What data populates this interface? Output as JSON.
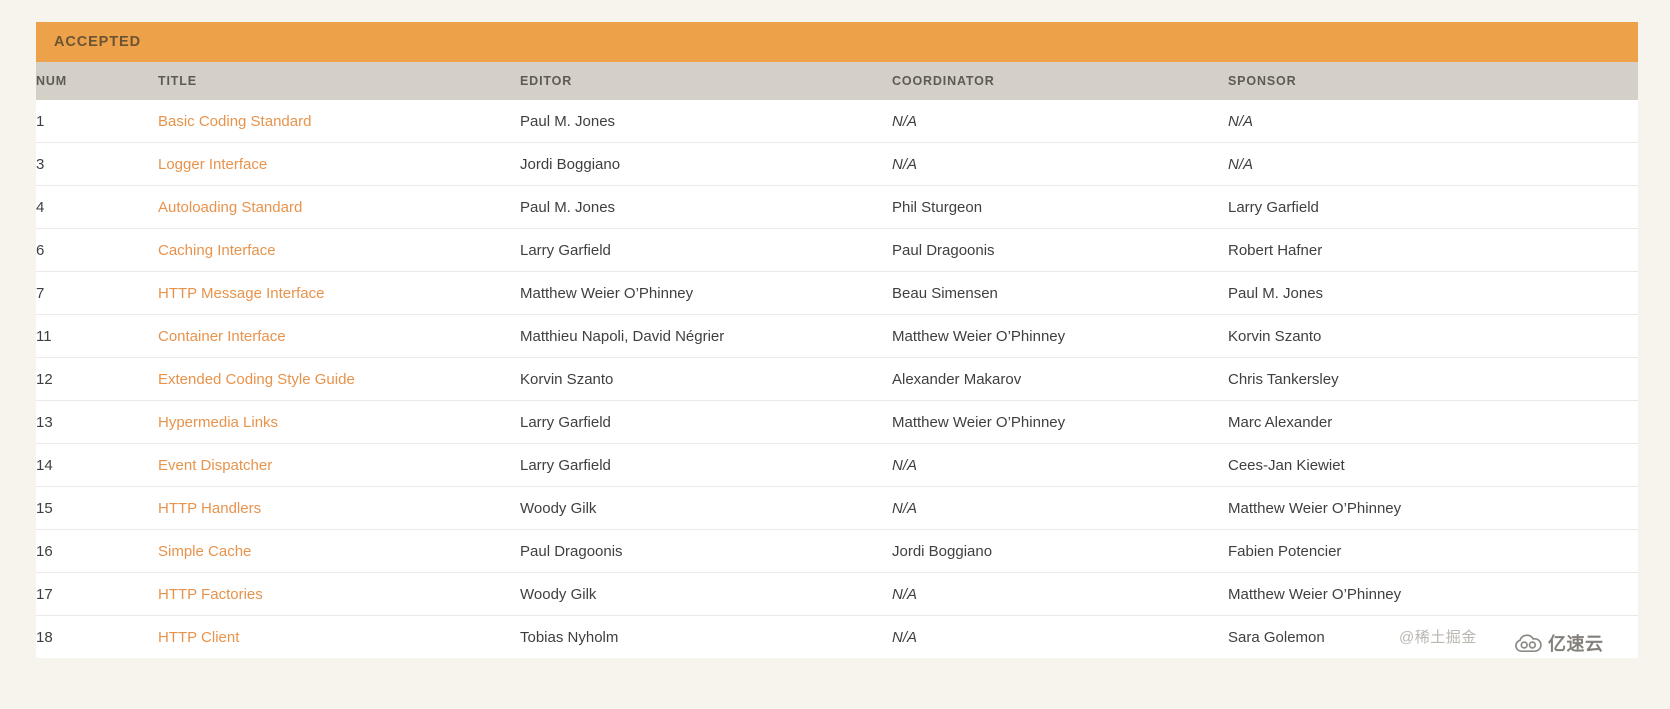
{
  "section": {
    "title": "ACCEPTED",
    "header_bg": "#eda149",
    "header_text_color": "#6b5433"
  },
  "table": {
    "columns": [
      {
        "key": "num",
        "label": "NUM"
      },
      {
        "key": "title",
        "label": "TITLE"
      },
      {
        "key": "editor",
        "label": "EDITOR"
      },
      {
        "key": "coordinator",
        "label": "COORDINATOR"
      },
      {
        "key": "sponsor",
        "label": "SPONSOR"
      }
    ],
    "link_color": "#e8934c",
    "header_row_bg": "#d4d0c8",
    "rows": [
      {
        "num": "1",
        "title": "Basic Coding Standard",
        "editor": "Paul M. Jones",
        "coordinator": "N/A",
        "sponsor": "N/A",
        "coordinator_na": true,
        "sponsor_na": true
      },
      {
        "num": "3",
        "title": "Logger Interface",
        "editor": "Jordi Boggiano",
        "coordinator": "N/A",
        "sponsor": "N/A",
        "coordinator_na": true,
        "sponsor_na": true
      },
      {
        "num": "4",
        "title": "Autoloading Standard",
        "editor": "Paul M. Jones",
        "coordinator": "Phil Sturgeon",
        "sponsor": "Larry Garfield",
        "coordinator_na": false,
        "sponsor_na": false
      },
      {
        "num": "6",
        "title": "Caching Interface",
        "editor": "Larry Garfield",
        "coordinator": "Paul Dragoonis",
        "sponsor": "Robert Hafner",
        "coordinator_na": false,
        "sponsor_na": false
      },
      {
        "num": "7",
        "title": "HTTP Message Interface",
        "editor": "Matthew Weier O’Phinney",
        "coordinator": "Beau Simensen",
        "sponsor": "Paul M. Jones",
        "coordinator_na": false,
        "sponsor_na": false
      },
      {
        "num": "11",
        "title": "Container Interface",
        "editor": "Matthieu Napoli, David Négrier",
        "coordinator": "Matthew Weier O’Phinney",
        "sponsor": "Korvin Szanto",
        "coordinator_na": false,
        "sponsor_na": false
      },
      {
        "num": "12",
        "title": "Extended Coding Style Guide",
        "editor": "Korvin Szanto",
        "coordinator": "Alexander Makarov",
        "sponsor": "Chris Tankersley",
        "coordinator_na": false,
        "sponsor_na": false
      },
      {
        "num": "13",
        "title": "Hypermedia Links",
        "editor": "Larry Garfield",
        "coordinator": "Matthew Weier O’Phinney",
        "sponsor": "Marc Alexander",
        "coordinator_na": false,
        "sponsor_na": false
      },
      {
        "num": "14",
        "title": "Event Dispatcher",
        "editor": "Larry Garfield",
        "coordinator": "N/A",
        "sponsor": "Cees-Jan Kiewiet",
        "coordinator_na": true,
        "sponsor_na": false
      },
      {
        "num": "15",
        "title": "HTTP Handlers",
        "editor": "Woody Gilk",
        "coordinator": "N/A",
        "sponsor": "Matthew Weier O’Phinney",
        "coordinator_na": true,
        "sponsor_na": false
      },
      {
        "num": "16",
        "title": "Simple Cache",
        "editor": "Paul Dragoonis",
        "coordinator": "Jordi Boggiano",
        "sponsor": "Fabien Potencier",
        "coordinator_na": false,
        "sponsor_na": false
      },
      {
        "num": "17",
        "title": "HTTP Factories",
        "editor": "Woody Gilk",
        "coordinator": "N/A",
        "sponsor": "Matthew Weier O’Phinney",
        "coordinator_na": true,
        "sponsor_na": false
      },
      {
        "num": "18",
        "title": "HTTP Client",
        "editor": "Tobias Nyholm",
        "coordinator": "N/A",
        "sponsor": "Sara Golemon",
        "coordinator_na": true,
        "sponsor_na": false
      }
    ]
  },
  "watermarks": {
    "juejin": "@稀土掘金",
    "yisu_text": "亿速云",
    "yisu_icon": "cloud-icon"
  }
}
